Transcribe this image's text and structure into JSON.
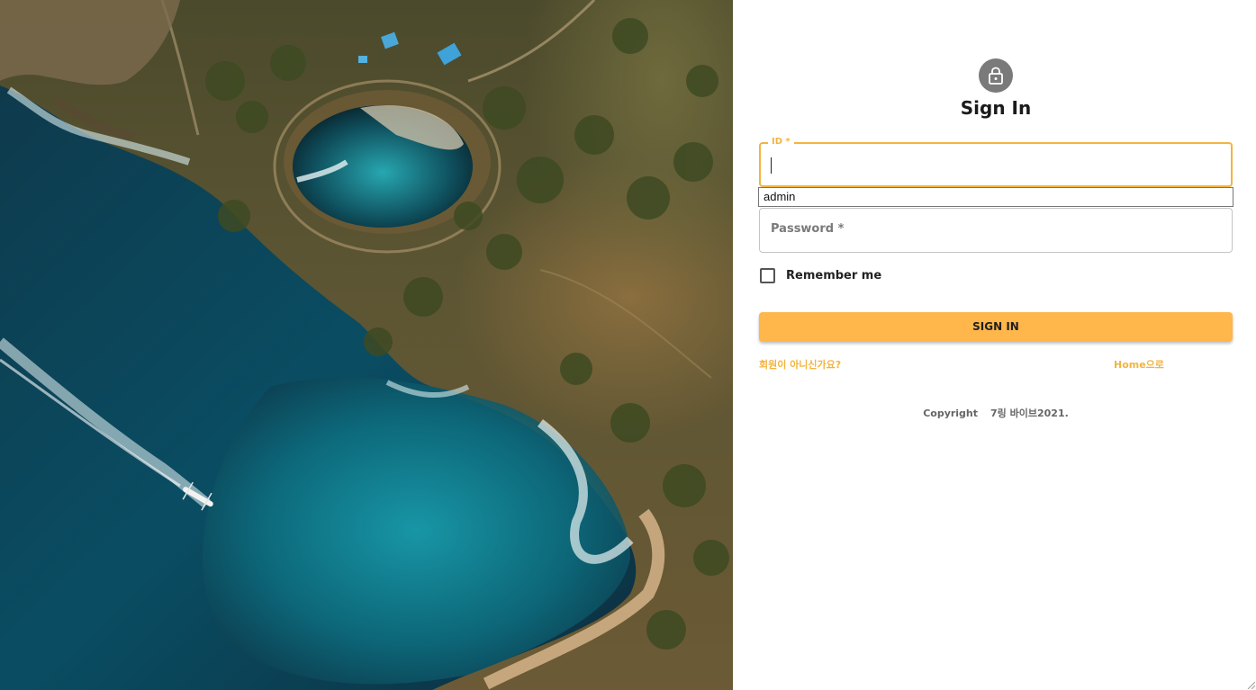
{
  "hero": {
    "icon": "aerial-coast-image"
  },
  "header": {
    "icon": "lock-icon",
    "title": "Sign In"
  },
  "form": {
    "id_label": "ID *",
    "id_value": "",
    "autocomplete_suggestion": "admin",
    "password_label": "Password *",
    "remember_label": "Remember me",
    "remember_checked": false,
    "submit_label": "SIGN IN"
  },
  "links": {
    "signup": "회원이 아니신가요?",
    "home": "Home으로"
  },
  "footer": {
    "copyright_prefix": "Copyright",
    "copyright_text": "7링 바이브2021."
  },
  "colors": {
    "accent": "#ffb64a",
    "focus_border": "#f3b340",
    "avatar_bg": "#7a7a7a"
  }
}
